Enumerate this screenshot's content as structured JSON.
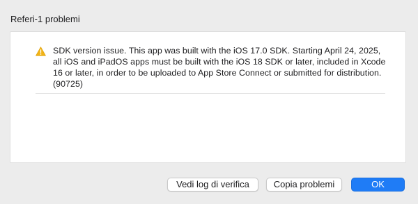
{
  "dialog": {
    "title": "Referi-1 problemi"
  },
  "issues": [
    {
      "severity_icon": "warning-icon",
      "severity_color": "#f2b417",
      "text": "SDK version issue. This app was built with the iOS 17.0 SDK. Starting April 24, 2025, all iOS and iPadOS apps must be built with the iOS 18 SDK or later, included in Xcode 16 or later, in order to be uploaded to App Store Connect or submitted for distribution. (90725)"
    }
  ],
  "buttons": {
    "view_log_label": "Vedi log di verifica",
    "copy_issues_label": "Copia problemi",
    "ok_label": "OK"
  },
  "colors": {
    "accent": "#1f7cf6",
    "warning": "#f2b417",
    "window_bg": "#ececec",
    "panel_bg": "#ffffff"
  }
}
